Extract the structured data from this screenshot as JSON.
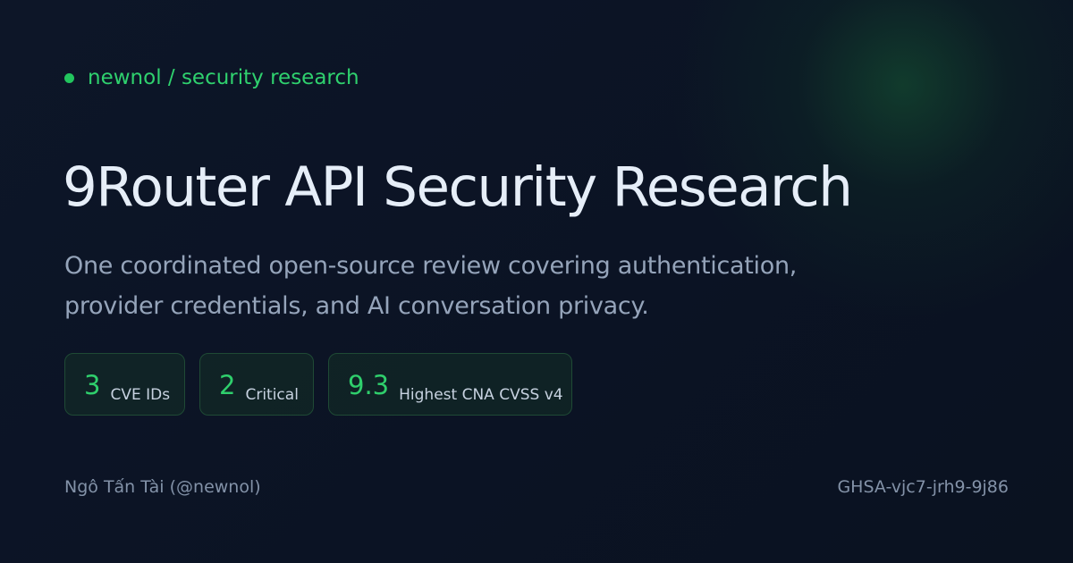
{
  "kicker": "newnol / security research",
  "title": "9Router API Security Research",
  "subtitle": "One coordinated open-source review covering authentication, provider credentials, and AI conversation privacy.",
  "stats": [
    {
      "value": "3",
      "label": "CVE IDs"
    },
    {
      "value": "2",
      "label": "Critical"
    },
    {
      "value": "9.3",
      "label": "Highest CNA CVSS v4"
    }
  ],
  "footer": {
    "author": "Ngô Tấn Tài (@newnol)",
    "advisory": "GHSA-vjc7-jrh9-9j86"
  },
  "colors": {
    "background": "#0c1424",
    "accent": "#22c55e",
    "title": "#e6eef8",
    "muted": "#8392a8"
  }
}
